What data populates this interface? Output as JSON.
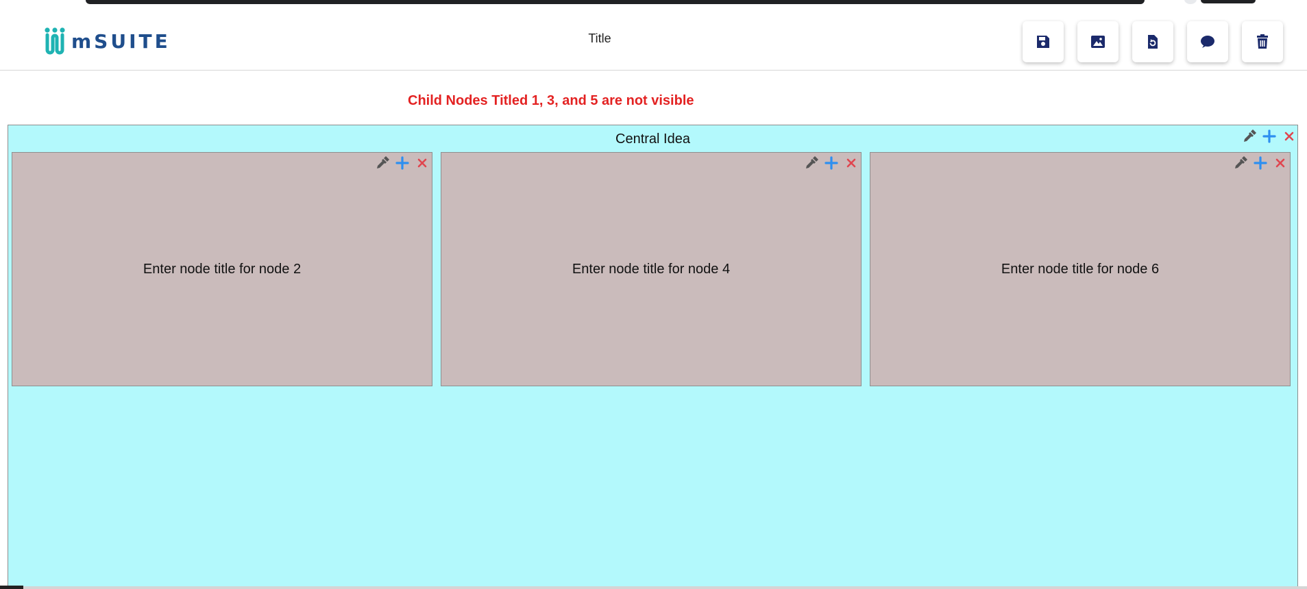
{
  "app": {
    "logo_text": "mSUITE",
    "title": "Title"
  },
  "toolbar": {
    "buttons": [
      {
        "name": "save",
        "icon": "floppy-disk-icon"
      },
      {
        "name": "export-image",
        "icon": "image-icon"
      },
      {
        "name": "reload",
        "icon": "file-refresh-icon"
      },
      {
        "name": "chat",
        "icon": "chat-bubble-icon"
      },
      {
        "name": "delete",
        "icon": "trash-icon"
      }
    ],
    "icon_color": "#1b2a6b"
  },
  "notice": "Child Nodes Titled 1, 3, and 5 are not visible",
  "central_node": {
    "title": "Central Idea",
    "background": "#b3f9fc"
  },
  "child_nodes": [
    {
      "title": "Enter node title for node 2"
    },
    {
      "title": "Enter node title for node 4"
    },
    {
      "title": "Enter node title for node 6"
    }
  ],
  "colors": {
    "child_background": "#cabbbb",
    "notice": "#e32222",
    "add_icon": "#2d8ff0",
    "remove_icon": "#e0454f",
    "color_picker_icon": "#555555"
  }
}
